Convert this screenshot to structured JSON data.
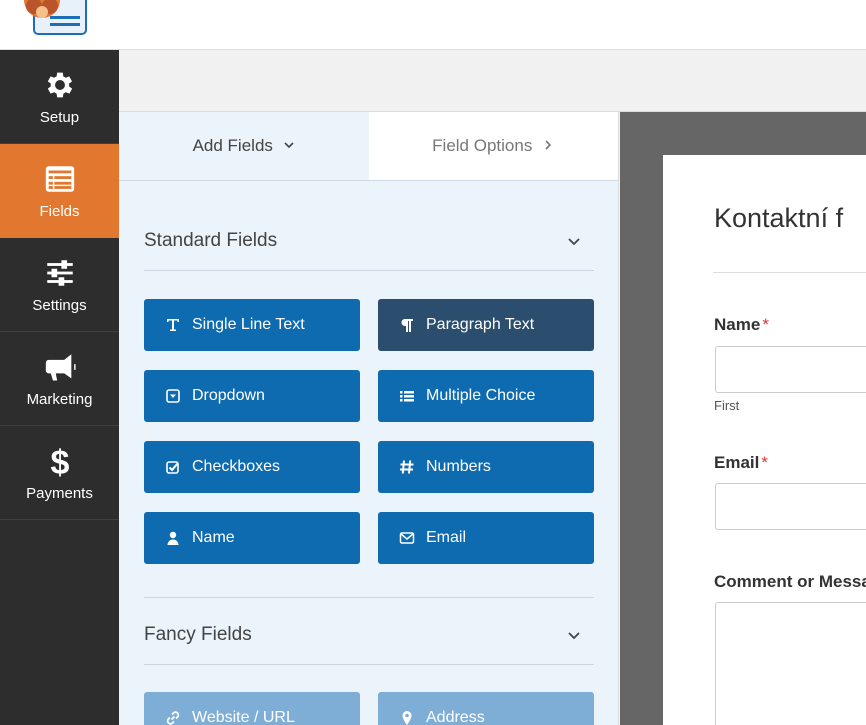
{
  "sidebar": {
    "items": [
      {
        "label": "Setup",
        "icon": "gear-icon"
      },
      {
        "label": "Fields",
        "icon": "fields-list-icon",
        "active": true
      },
      {
        "label": "Settings",
        "icon": "sliders-icon"
      },
      {
        "label": "Marketing",
        "icon": "megaphone-icon"
      },
      {
        "label": "Payments",
        "icon": "dollar-icon"
      }
    ]
  },
  "panel": {
    "tabs": {
      "add_fields": "Add Fields",
      "field_options": "Field Options"
    },
    "standard": {
      "title": "Standard Fields",
      "buttons": [
        {
          "label": "Single Line Text",
          "icon": "text-icon"
        },
        {
          "label": "Paragraph Text",
          "icon": "paragraph-icon"
        },
        {
          "label": "Dropdown",
          "icon": "dropdown-icon"
        },
        {
          "label": "Multiple Choice",
          "icon": "list-icon"
        },
        {
          "label": "Checkboxes",
          "icon": "checkbox-icon"
        },
        {
          "label": "Numbers",
          "icon": "hash-icon"
        },
        {
          "label": "Name",
          "icon": "user-icon"
        },
        {
          "label": "Email",
          "icon": "envelope-icon"
        }
      ]
    },
    "fancy": {
      "title": "Fancy Fields",
      "buttons": [
        {
          "label": "Website / URL",
          "icon": "link-icon"
        },
        {
          "label": "Address",
          "icon": "map-marker-icon"
        }
      ]
    }
  },
  "preview": {
    "form_title": "Kontaktní f",
    "fields": [
      {
        "label": "Name",
        "required": "*",
        "sublabel": "First"
      },
      {
        "label": "Email",
        "required": "*"
      },
      {
        "label": "Comment or Messa"
      }
    ]
  },
  "colors": {
    "accent": "#e27730",
    "sidebar_bg": "#2d2d2d",
    "button_blue": "#0e6bb0",
    "button_active": "#2b4d6e",
    "panel_bg": "#ebf3fb"
  }
}
